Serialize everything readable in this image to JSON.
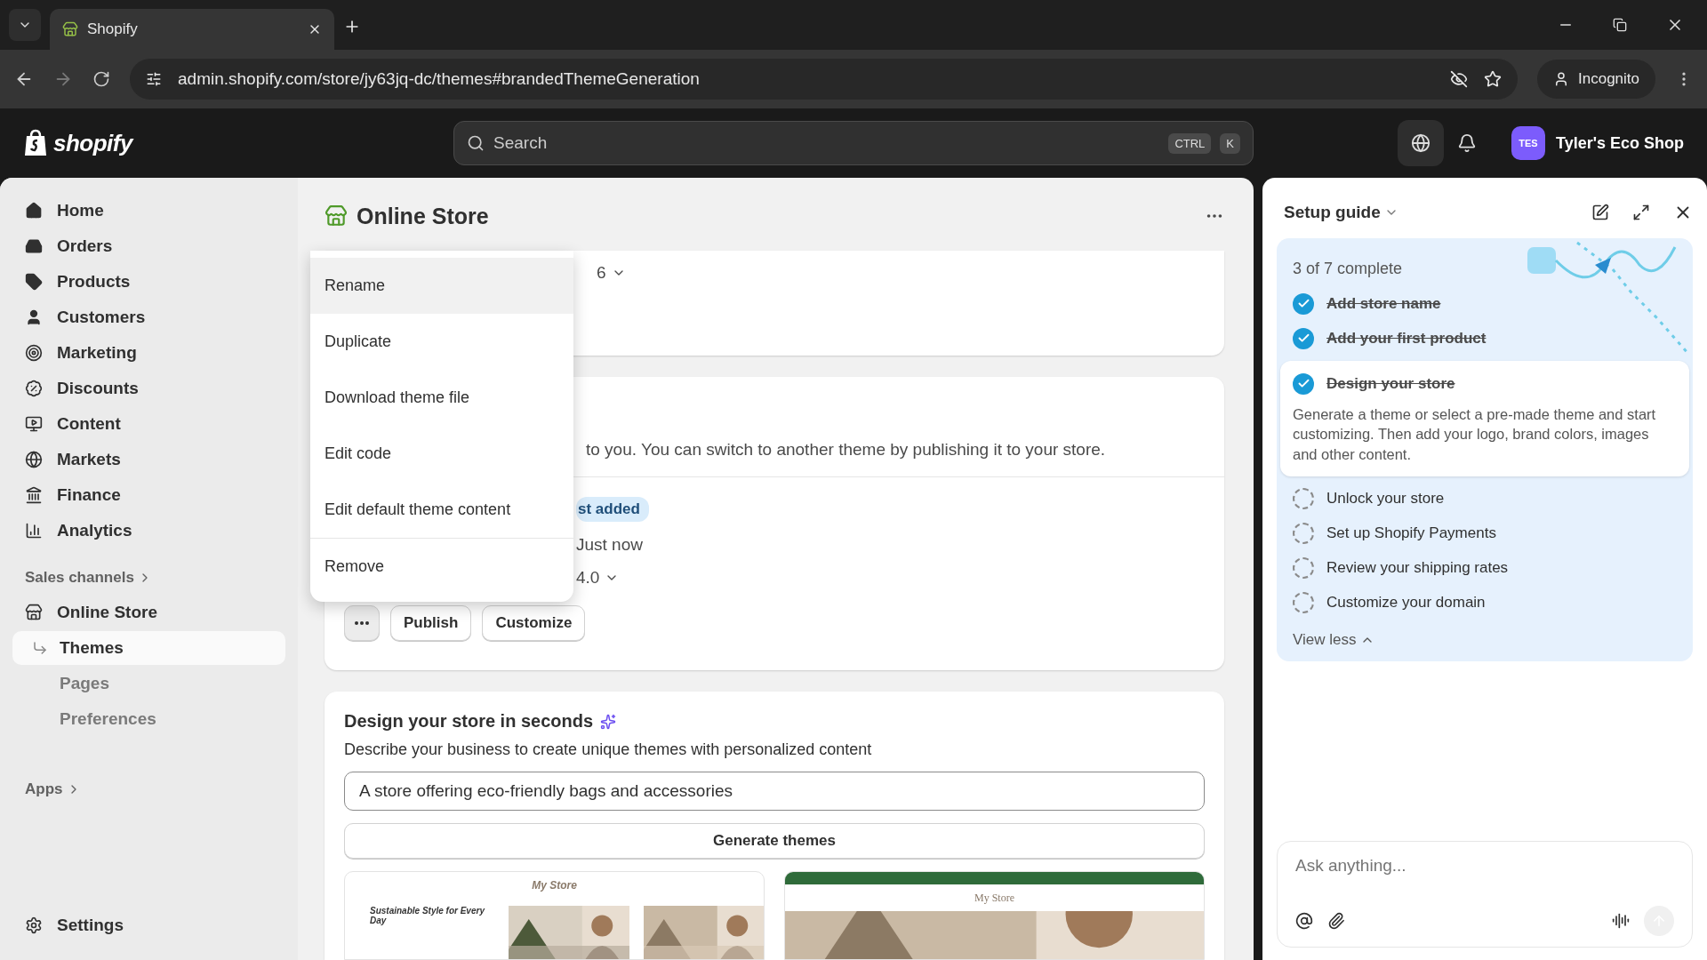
{
  "browser": {
    "tab_title": "Shopify",
    "url": "admin.shopify.com/store/jy63jq-dc/themes#brandedThemeGeneration",
    "profile": "Incognito"
  },
  "topbar": {
    "logo": "shopify",
    "search_placeholder": "Search",
    "shortcut": [
      "CTRL",
      "K"
    ],
    "avatar": "TES",
    "store_name": "Tyler's Eco Shop"
  },
  "sidebar": {
    "items": [
      {
        "label": "Home",
        "selected": false
      },
      {
        "label": "Orders",
        "selected": false
      },
      {
        "label": "Products",
        "selected": false
      },
      {
        "label": "Customers",
        "selected": false
      },
      {
        "label": "Marketing",
        "selected": false
      },
      {
        "label": "Discounts",
        "selected": false
      },
      {
        "label": "Content",
        "selected": false
      },
      {
        "label": "Markets",
        "selected": false
      },
      {
        "label": "Finance",
        "selected": false
      },
      {
        "label": "Analytics",
        "selected": false
      }
    ],
    "sales_channels": "Sales channels",
    "channel": "Online Store",
    "sub_items": [
      {
        "label": "Themes",
        "selected": true
      },
      {
        "label": "Pages",
        "selected": false
      },
      {
        "label": "Preferences",
        "selected": false
      }
    ],
    "apps": "Apps",
    "settings": "Settings"
  },
  "main": {
    "title": "Online Store",
    "menu": [
      {
        "label": "Rename",
        "hovered": true
      },
      {
        "label": "Duplicate",
        "hovered": false
      },
      {
        "label": "Download theme file",
        "hovered": false
      },
      {
        "label": "Edit code",
        "hovered": false
      },
      {
        "label": "Edit default theme content",
        "hovered": false
      },
      {
        "label": "Remove",
        "hovered": false
      }
    ],
    "card_1": {
      "version_fragment": "6"
    },
    "card_2": {
      "description_fragment": "to you. You can switch to another theme by publishing it to your store.",
      "badge_fragment": "st added",
      "saved": "Just now",
      "version_fragment": "4.0",
      "buttons": [
        "Publish",
        "Customize"
      ]
    },
    "generator": {
      "title": "Design your store in seconds",
      "description": "Describe your business to create unique themes with personalized content",
      "prompt": "A store offering eco-friendly bags and accessories",
      "button": "Generate themes",
      "previews": [
        {
          "store": "My Store",
          "headline": "Sustainable Style for Every Day"
        },
        {
          "store": "My Store"
        }
      ]
    }
  },
  "setup_guide": {
    "title": "Setup guide",
    "progress": "3 of 7 complete",
    "tasks": [
      {
        "label": "Add store name",
        "done": true,
        "expanded": false
      },
      {
        "label": "Add your first product",
        "done": true,
        "expanded": false
      },
      {
        "label": "Design your store",
        "done": true,
        "expanded": true,
        "description": "Generate a theme or select a pre-made theme and start customizing. Then add your logo, brand colors, images and other content."
      },
      {
        "label": "Unlock your store",
        "done": false,
        "expanded": false
      },
      {
        "label": "Set up Shopify Payments",
        "done": false,
        "expanded": false
      },
      {
        "label": "Review your shipping rates",
        "done": false,
        "expanded": false
      },
      {
        "label": "Customize your domain",
        "done": false,
        "expanded": false
      }
    ],
    "toggle": "View less",
    "chat_placeholder": "Ask anything..."
  }
}
